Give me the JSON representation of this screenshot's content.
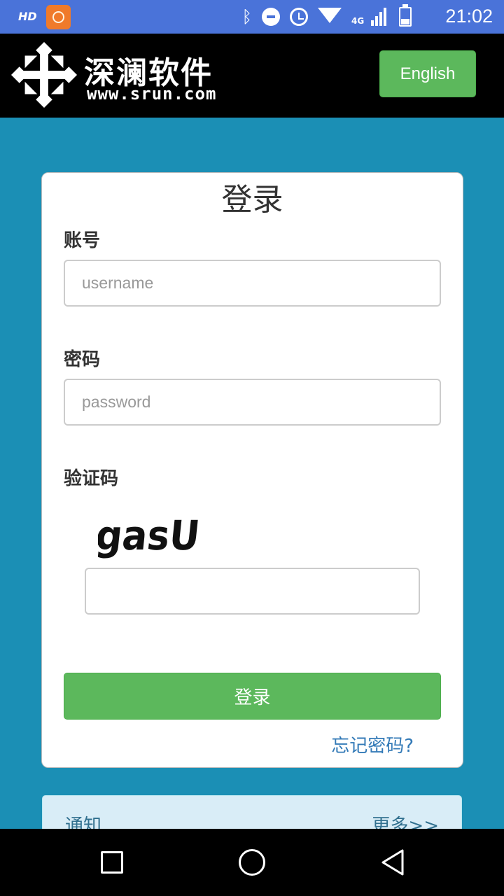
{
  "status_bar": {
    "hd_label": "HD",
    "network_label": "4G",
    "time": "21:02",
    "icons": [
      "app-notification-icon",
      "bluetooth-icon",
      "do-not-disturb-icon",
      "alarm-icon",
      "wifi-icon",
      "signal-icon",
      "battery-icon"
    ]
  },
  "header": {
    "logo_title": "深澜软件",
    "logo_url": "www.srun.com",
    "language_button": "English"
  },
  "login": {
    "title": "登录",
    "username_label": "账号",
    "username_placeholder": "username",
    "password_label": "密码",
    "password_placeholder": "password",
    "captcha_label": "验证码",
    "captcha_text": "gasU",
    "submit_label": "登录",
    "forgot_link": "忘记密码?"
  },
  "notice": {
    "title": "通知",
    "more_link": "更多>>"
  },
  "nav_bar": {
    "buttons": [
      "recents-icon",
      "home-icon",
      "back-icon"
    ]
  },
  "colors": {
    "status_bar": "#4a73d9",
    "header_bg": "#000000",
    "page_bg": "#1b8fb5",
    "primary_button": "#5cb85c",
    "link": "#337ab7",
    "notice_bg": "#d9edf7"
  }
}
